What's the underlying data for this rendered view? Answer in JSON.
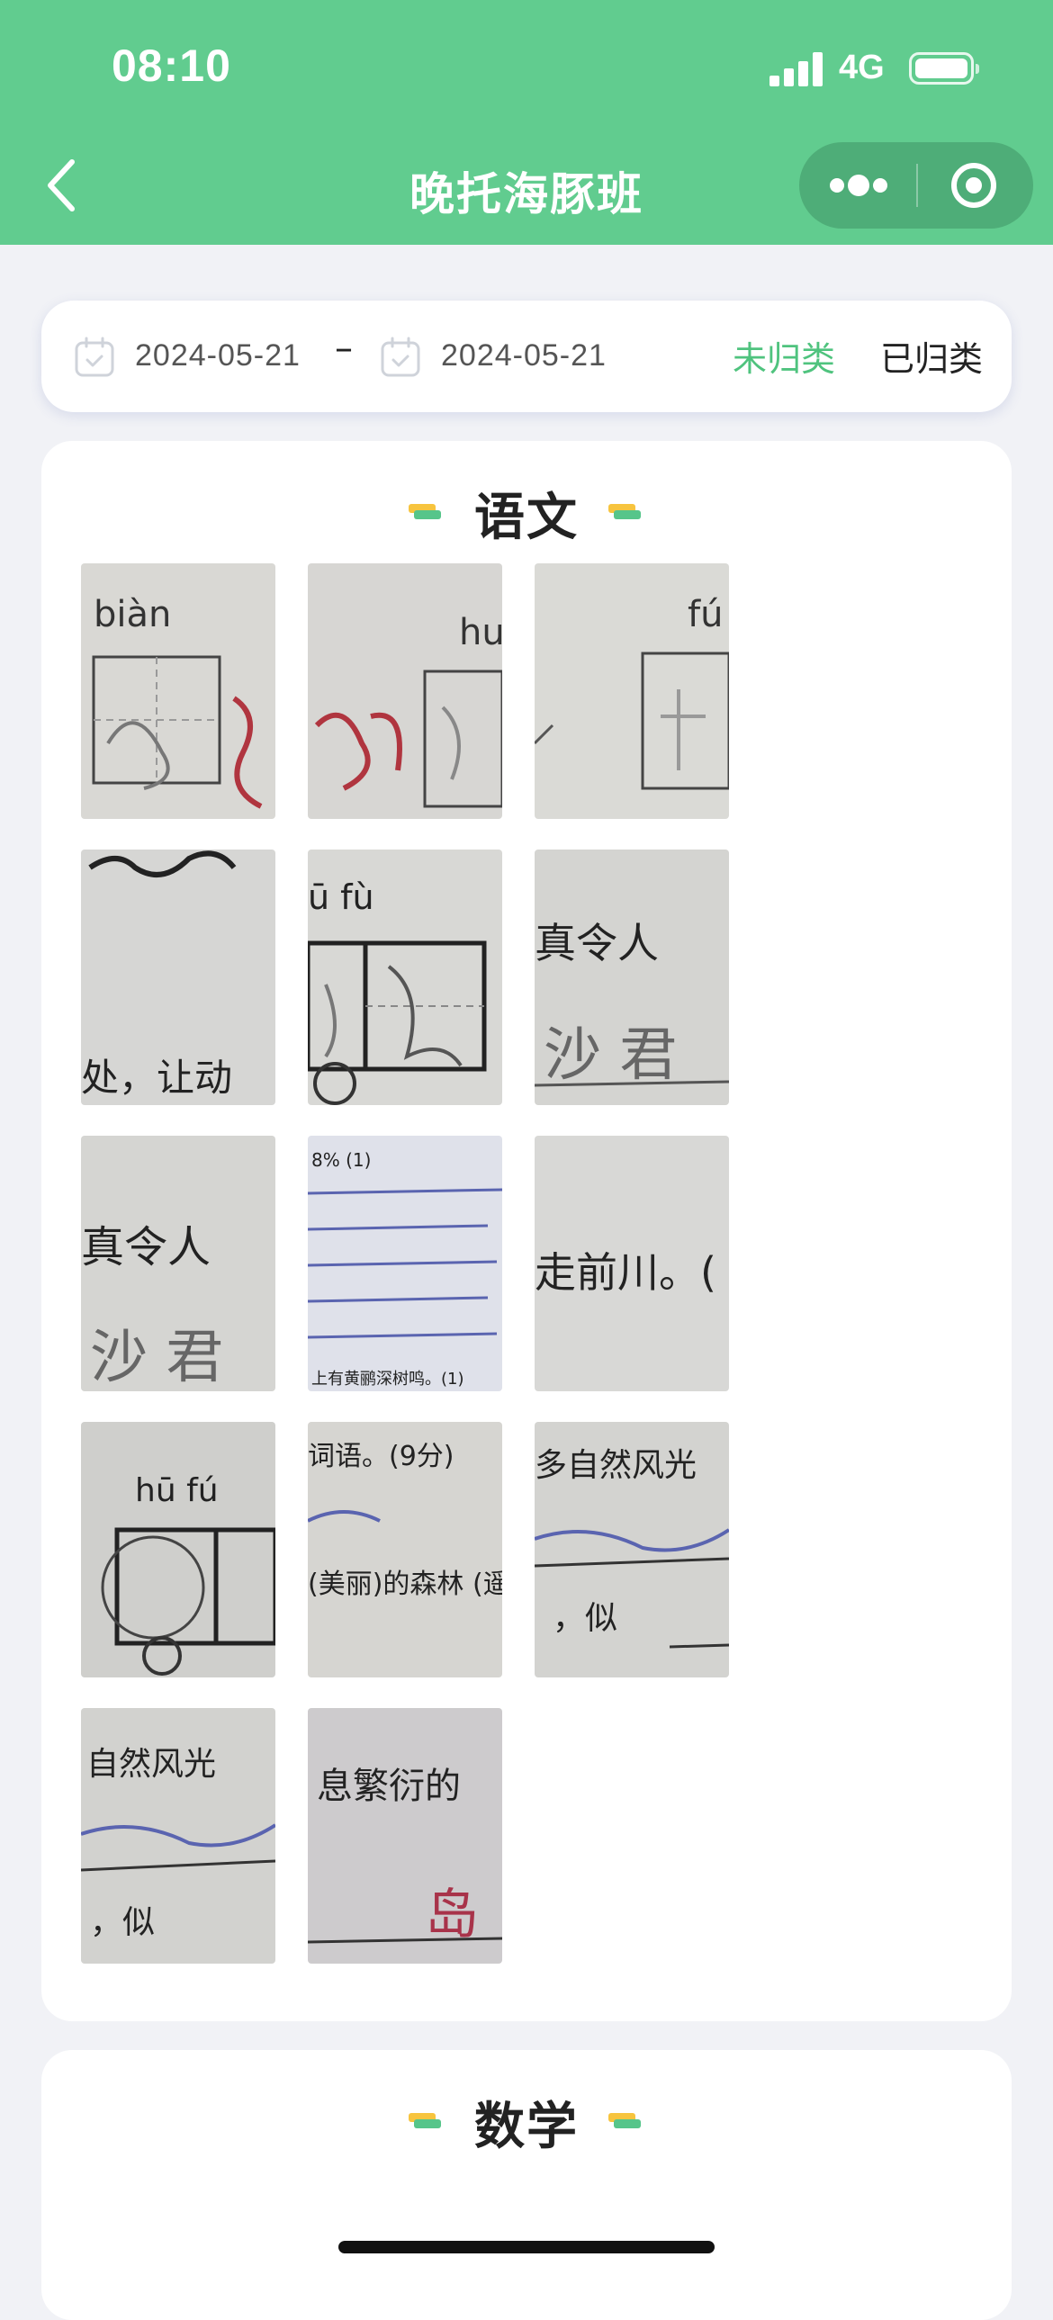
{
  "status_bar": {
    "time": "08:10",
    "network": "4G"
  },
  "nav": {
    "title": "晚托海豚班",
    "back_icon": "chevron-left-icon",
    "more_icon": "more-dots-icon",
    "close_icon": "target-circle-icon"
  },
  "filter": {
    "start_date": "2024-05-21",
    "separator": "–",
    "end_date": "2024-05-21",
    "calendar_icon": "calendar-icon",
    "tabs": [
      {
        "label": "未归类",
        "active": true
      },
      {
        "label": "已归类",
        "active": false
      }
    ]
  },
  "colors": {
    "brand_green": "#61cc8f",
    "active_tab": "#4fc37e",
    "page_bg": "#f1f2f6",
    "deco_yellow": "#f7c43e",
    "deco_green": "#56c58a"
  },
  "sections": [
    {
      "title": "语文",
      "photos": [
        {
          "id": "p1",
          "snippet": "biàn",
          "snippet2": ""
        },
        {
          "id": "p2",
          "snippet": "hu",
          "snippet2": ""
        },
        {
          "id": "p3",
          "snippet": "fú",
          "snippet2": ""
        },
        {
          "id": "p4",
          "snippet": "",
          "snippet2": "处，让动"
        },
        {
          "id": "p5",
          "snippet": "ū  fù",
          "snippet2": ""
        },
        {
          "id": "p6",
          "snippet": "真令人",
          "snippet2": "沙 君"
        },
        {
          "id": "p7",
          "snippet": "真令人",
          "snippet2": "沙 君"
        },
        {
          "id": "p8",
          "snippet": "8% (1)",
          "snippet2": "上有黄鹂深树鸣。(1)"
        },
        {
          "id": "p9",
          "snippet": "走前川。(",
          "snippet2": ""
        },
        {
          "id": "p10",
          "snippet": "hū   fú",
          "snippet2": ""
        },
        {
          "id": "p11",
          "snippet": "词语。(9分)",
          "snippet2": "(美丽)的森林 (遥远)的路途"
        },
        {
          "id": "p12",
          "snippet": "多自然风光",
          "snippet2": "，似"
        },
        {
          "id": "p13",
          "snippet": "自然风光",
          "snippet2": "，似"
        },
        {
          "id": "p14",
          "snippet": "息繁衍的",
          "snippet2": "岛"
        }
      ]
    },
    {
      "title": "数学",
      "photos": []
    }
  ]
}
